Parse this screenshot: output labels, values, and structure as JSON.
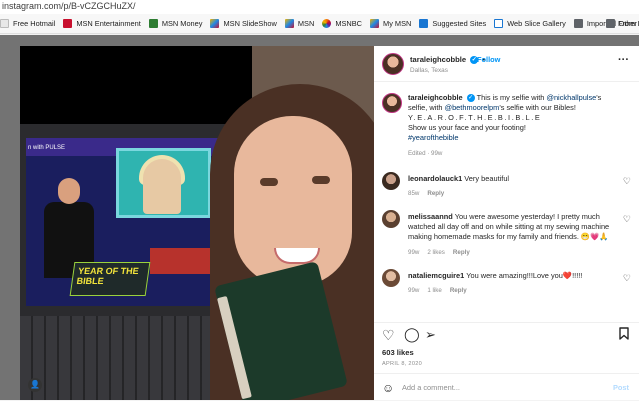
{
  "browser": {
    "url": "instagram.com/p/B-vCZGCHuZX/",
    "favorites": [
      {
        "label": "Free Hotmail",
        "icon": "page-icon",
        "color": "#e8e8e8"
      },
      {
        "label": "MSN Entertainment",
        "icon": "msn-icon",
        "color": "#c8102e"
      },
      {
        "label": "MSN Money",
        "icon": "msn-icon",
        "color": "#2e7d32"
      },
      {
        "label": "MSN SlideShow",
        "icon": "msn-butterfly-icon",
        "color": "#1e88e5"
      },
      {
        "label": "MSN",
        "icon": "msn-butterfly-icon",
        "color": "#1e88e5"
      },
      {
        "label": "MSNBC",
        "icon": "msnbc-peacock-icon",
        "color": "#f57c00"
      },
      {
        "label": "My MSN",
        "icon": "msn-butterfly-icon",
        "color": "#1e88e5"
      },
      {
        "label": "Suggested Sites",
        "icon": "bing-icon",
        "color": "#1976d2"
      },
      {
        "label": "Web Slice Gallery",
        "icon": "page-icon",
        "color": "#1976d2"
      },
      {
        "label": "Imported From IE",
        "icon": "folder-icon",
        "color": "#5f6368"
      }
    ],
    "other_label": "Other"
  },
  "post": {
    "username": "taraleighcobble",
    "follow_label": "Follow",
    "location": "Dallas, Texas",
    "more_label": "···",
    "caption": {
      "part1": "This is my selfie with ",
      "mention1": "@nickhallpulse",
      "part2": "'s selfie, with ",
      "mention2": "@bethmoorelpm",
      "part3": "'s selfie with our Bibles!",
      "line2": "Y.E.A.R.O.F.T.H.E.B.I.B.L.E",
      "line3": "Show us your face and your footing!",
      "hashtag": "#yearofthebible",
      "meta": "Edited · 99w"
    },
    "comments": [
      {
        "username": "leonardolauck1",
        "text": "Very beautiful",
        "time": "85w",
        "likes": "",
        "reply": "Reply"
      },
      {
        "username": "melissaannd",
        "text": "You were awesome yesterday! I pretty much watched all day off and on while sitting at my sewing machine making homemade masks for my family and friends. 😁💗🙏",
        "time": "99w",
        "likes": "2 likes",
        "reply": "Reply"
      },
      {
        "username": "nataliemcguire1",
        "text": "You were amazing!!!Love you❤️!!!!!",
        "time": "99w",
        "likes": "1 like",
        "reply": "Reply"
      }
    ],
    "likes": "603 likes",
    "date": "APRIL 8, 2020",
    "add_comment_placeholder": "Add a comment...",
    "post_label": "Post"
  },
  "photo": {
    "screen_label": "n with PULSE",
    "screen_graphic": "YEAR OF THE BIBLE"
  }
}
